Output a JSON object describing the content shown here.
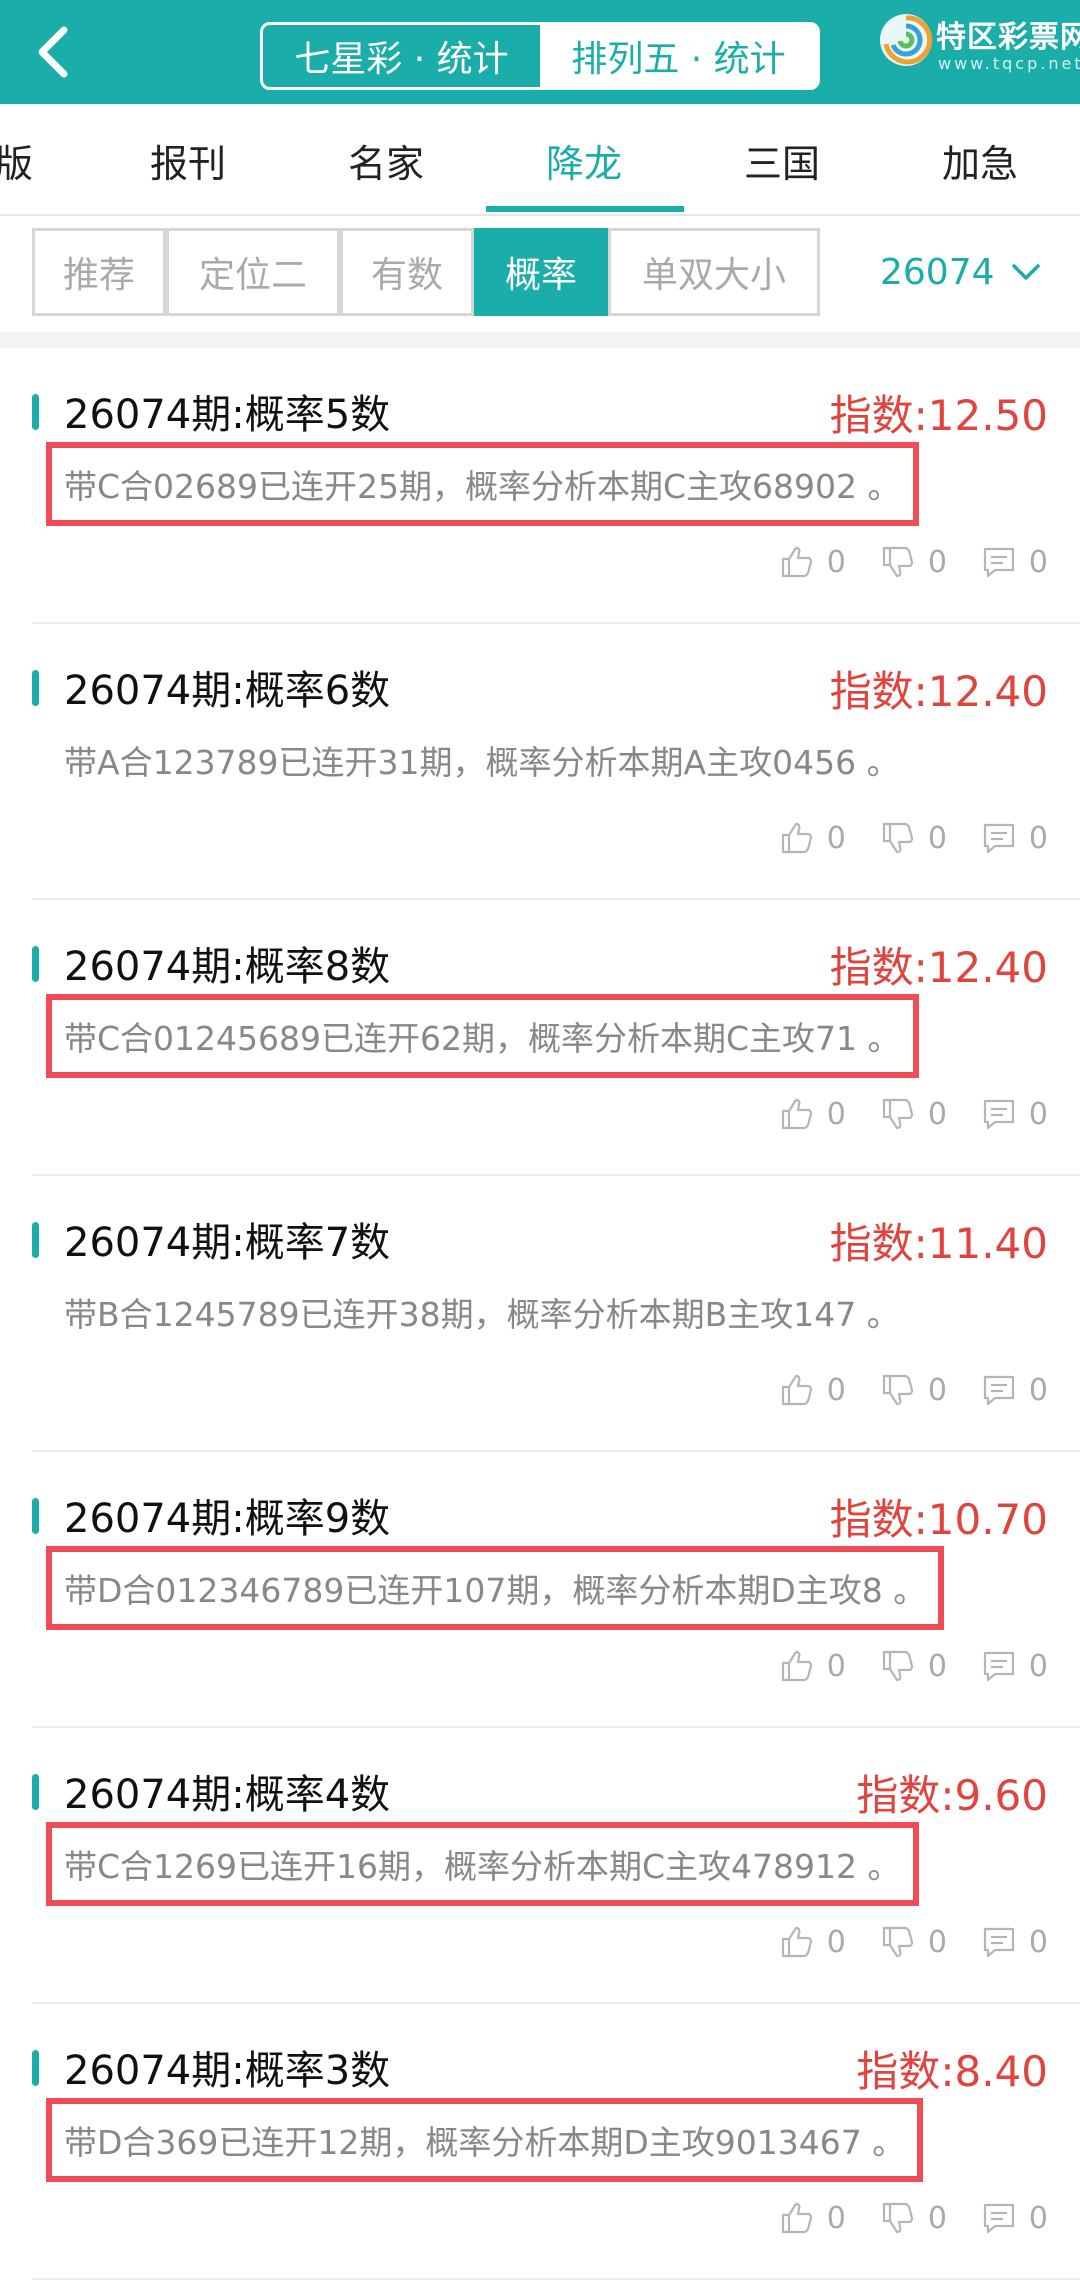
{
  "colors": {
    "primary": "#1aada9",
    "index_red": "#e0443e",
    "highlight_box": "#f04d56"
  },
  "header": {
    "back_icon": "chevron-left-icon",
    "segments": [
      {
        "label": "七星彩 · 统计",
        "active": false
      },
      {
        "label": "排列五 · 统计",
        "active": true
      }
    ],
    "logo": {
      "name": "特区彩票网",
      "url": "www.tqcp.net"
    }
  },
  "nav": {
    "tabs": [
      {
        "label": "版"
      },
      {
        "label": "报刊"
      },
      {
        "label": "名家"
      },
      {
        "label": "降龙",
        "active": true
      },
      {
        "label": "三国"
      },
      {
        "label": "加急"
      }
    ]
  },
  "filters": {
    "chips": [
      {
        "label": "推荐"
      },
      {
        "label": "定位二"
      },
      {
        "label": "有数"
      },
      {
        "label": "概率",
        "active": true
      },
      {
        "label": "单双大小"
      }
    ],
    "period": "26074",
    "period_icon": "chevron-down-icon"
  },
  "items": [
    {
      "title": "26074期:概率5数",
      "index": "指数:12.50",
      "desc": "带C合02689已连开25期，概率分析本期C主攻68902 。",
      "likes": "0",
      "dislikes": "0",
      "comments": "0",
      "highlighted": true
    },
    {
      "title": "26074期:概率6数",
      "index": "指数:12.40",
      "desc": "带A合123789已连开31期，概率分析本期A主攻0456 。",
      "likes": "0",
      "dislikes": "0",
      "comments": "0",
      "highlighted": false
    },
    {
      "title": "26074期:概率8数",
      "index": "指数:12.40",
      "desc": "带C合01245689已连开62期，概率分析本期C主攻71 。",
      "likes": "0",
      "dislikes": "0",
      "comments": "0",
      "highlighted": true
    },
    {
      "title": "26074期:概率7数",
      "index": "指数:11.40",
      "desc": "带B合1245789已连开38期，概率分析本期B主攻147 。",
      "likes": "0",
      "dislikes": "0",
      "comments": "0",
      "highlighted": false
    },
    {
      "title": "26074期:概率9数",
      "index": "指数:10.70",
      "desc": "带D合012346789已连开107期，概率分析本期D主攻8 。",
      "likes": "0",
      "dislikes": "0",
      "comments": "0",
      "highlighted": true
    },
    {
      "title": "26074期:概率4数",
      "index": "指数:9.60",
      "desc": "带C合1269已连开16期，概率分析本期C主攻478912 。",
      "likes": "0",
      "dislikes": "0",
      "comments": "0",
      "highlighted": true
    },
    {
      "title": "26074期:概率3数",
      "index": "指数:8.40",
      "desc": "带D合369已连开12期，概率分析本期D主攻9013467 。",
      "likes": "0",
      "dislikes": "0",
      "comments": "0",
      "highlighted": true
    }
  ]
}
